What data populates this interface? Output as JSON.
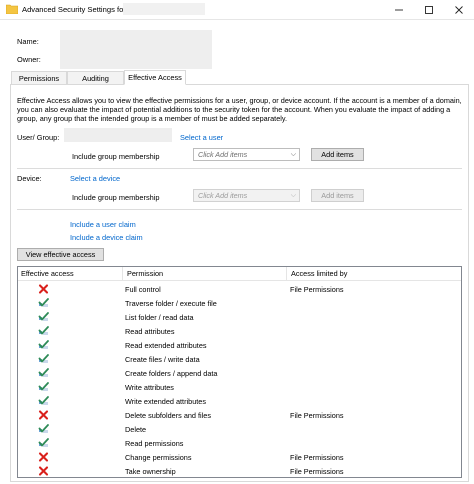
{
  "window": {
    "title": "Advanced Security Settings for",
    "controls": [
      "minimize-icon",
      "maximize-icon",
      "close-icon"
    ]
  },
  "header": {
    "name_label": "Name:",
    "owner_label": "Owner:"
  },
  "tabs": [
    {
      "label": "Permissions",
      "active": false
    },
    {
      "label": "Auditing",
      "active": false
    },
    {
      "label": "Effective Access",
      "active": true
    }
  ],
  "effective_access": {
    "description": "Effective Access allows you to view the effective permissions for a user, group, or device account. If the account is a member of a domain, you can also evaluate the impact of potential additions to the security token for the account. When you evaluate the impact of adding a group, any group that the intended group is a member of must be added separately.",
    "user_group_label": "User/ Group:",
    "select_user_link": "Select a user",
    "include_group_membership_label": "Include group membership",
    "group_combo_placeholder": "Click Add items",
    "add_items_label": "Add items",
    "device_label": "Device:",
    "select_device_link": "Select a device",
    "device_include_group_membership_label": "Include group membership",
    "device_combo_placeholder": "Click Add items",
    "device_add_items_label": "Add items",
    "include_user_claim_link": "Include a user claim",
    "include_device_claim_link": "Include a device claim",
    "view_button_label": "View effective access"
  },
  "table": {
    "columns": [
      "Effective access",
      "Permission",
      "Access limited by"
    ],
    "rows": [
      {
        "access": "denied",
        "permission": "Full control",
        "limited_by": "File Permissions"
      },
      {
        "access": "allowed",
        "permission": "Traverse folder / execute file",
        "limited_by": ""
      },
      {
        "access": "allowed",
        "permission": "List folder / read data",
        "limited_by": ""
      },
      {
        "access": "allowed",
        "permission": "Read attributes",
        "limited_by": ""
      },
      {
        "access": "allowed",
        "permission": "Read extended attributes",
        "limited_by": ""
      },
      {
        "access": "allowed",
        "permission": "Create files / write data",
        "limited_by": ""
      },
      {
        "access": "allowed",
        "permission": "Create folders / append data",
        "limited_by": ""
      },
      {
        "access": "allowed",
        "permission": "Write attributes",
        "limited_by": ""
      },
      {
        "access": "allowed",
        "permission": "Write extended attributes",
        "limited_by": ""
      },
      {
        "access": "denied",
        "permission": "Delete subfolders and files",
        "limited_by": "File Permissions"
      },
      {
        "access": "allowed",
        "permission": "Delete",
        "limited_by": ""
      },
      {
        "access": "allowed",
        "permission": "Read permissions",
        "limited_by": ""
      },
      {
        "access": "denied",
        "permission": "Change permissions",
        "limited_by": "File Permissions"
      },
      {
        "access": "denied",
        "permission": "Take ownership",
        "limited_by": "File Permissions"
      }
    ]
  },
  "colors": {
    "link": "#0066cc",
    "denied": "#d9201b",
    "allowed": "#2e8b57"
  }
}
